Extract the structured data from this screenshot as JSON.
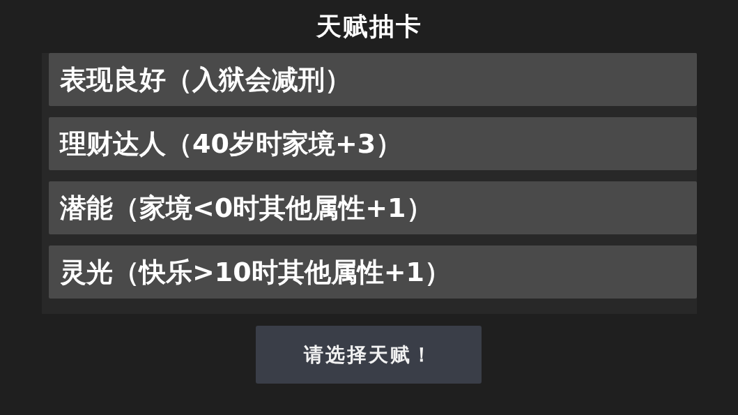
{
  "title": "天赋抽卡",
  "talents": [
    {
      "label": "表现良好（入狱会减刑）"
    },
    {
      "label": "理财达人（40岁时家境+3）"
    },
    {
      "label": "潜能（家境<0时其他属性+1）"
    },
    {
      "label": "灵光（快乐>10时其他属性+1）"
    }
  ],
  "button": {
    "label": "请选择天赋！"
  }
}
